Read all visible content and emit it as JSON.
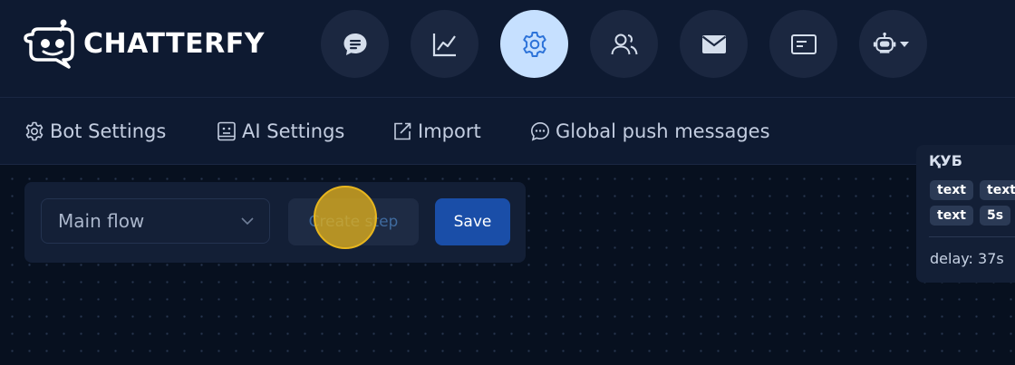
{
  "brand": {
    "name": "CHATTERFY"
  },
  "nav": {
    "items": [
      {
        "name": "chat",
        "icon": "chat-bubble-icon",
        "active": false
      },
      {
        "name": "analytics",
        "icon": "line-chart-icon",
        "active": false
      },
      {
        "name": "settings",
        "icon": "gear-icon",
        "active": true
      },
      {
        "name": "users",
        "icon": "users-icon",
        "active": false
      },
      {
        "name": "mail",
        "icon": "envelope-icon",
        "active": false
      },
      {
        "name": "pages",
        "icon": "window-icon",
        "active": false
      },
      {
        "name": "bot",
        "icon": "robot-icon",
        "active": false
      }
    ]
  },
  "subnav": {
    "bot_settings": "Bot Settings",
    "ai_settings": "AI Settings",
    "import": "Import",
    "global_push": "Global push messages"
  },
  "toolbar": {
    "flow_select_value": "Main flow",
    "create_step_label": "Create step",
    "save_label": "Save"
  },
  "node": {
    "title": "ҚУБ",
    "chips": [
      "text",
      "text",
      "text",
      "5s"
    ],
    "delay": "delay: 37s"
  },
  "colors": {
    "background": "#07101f",
    "header": "#0e1a31",
    "active_nav": "#c6e0ff",
    "save_button": "#1a4ea8",
    "cursor_highlight": "#e8b61e"
  }
}
